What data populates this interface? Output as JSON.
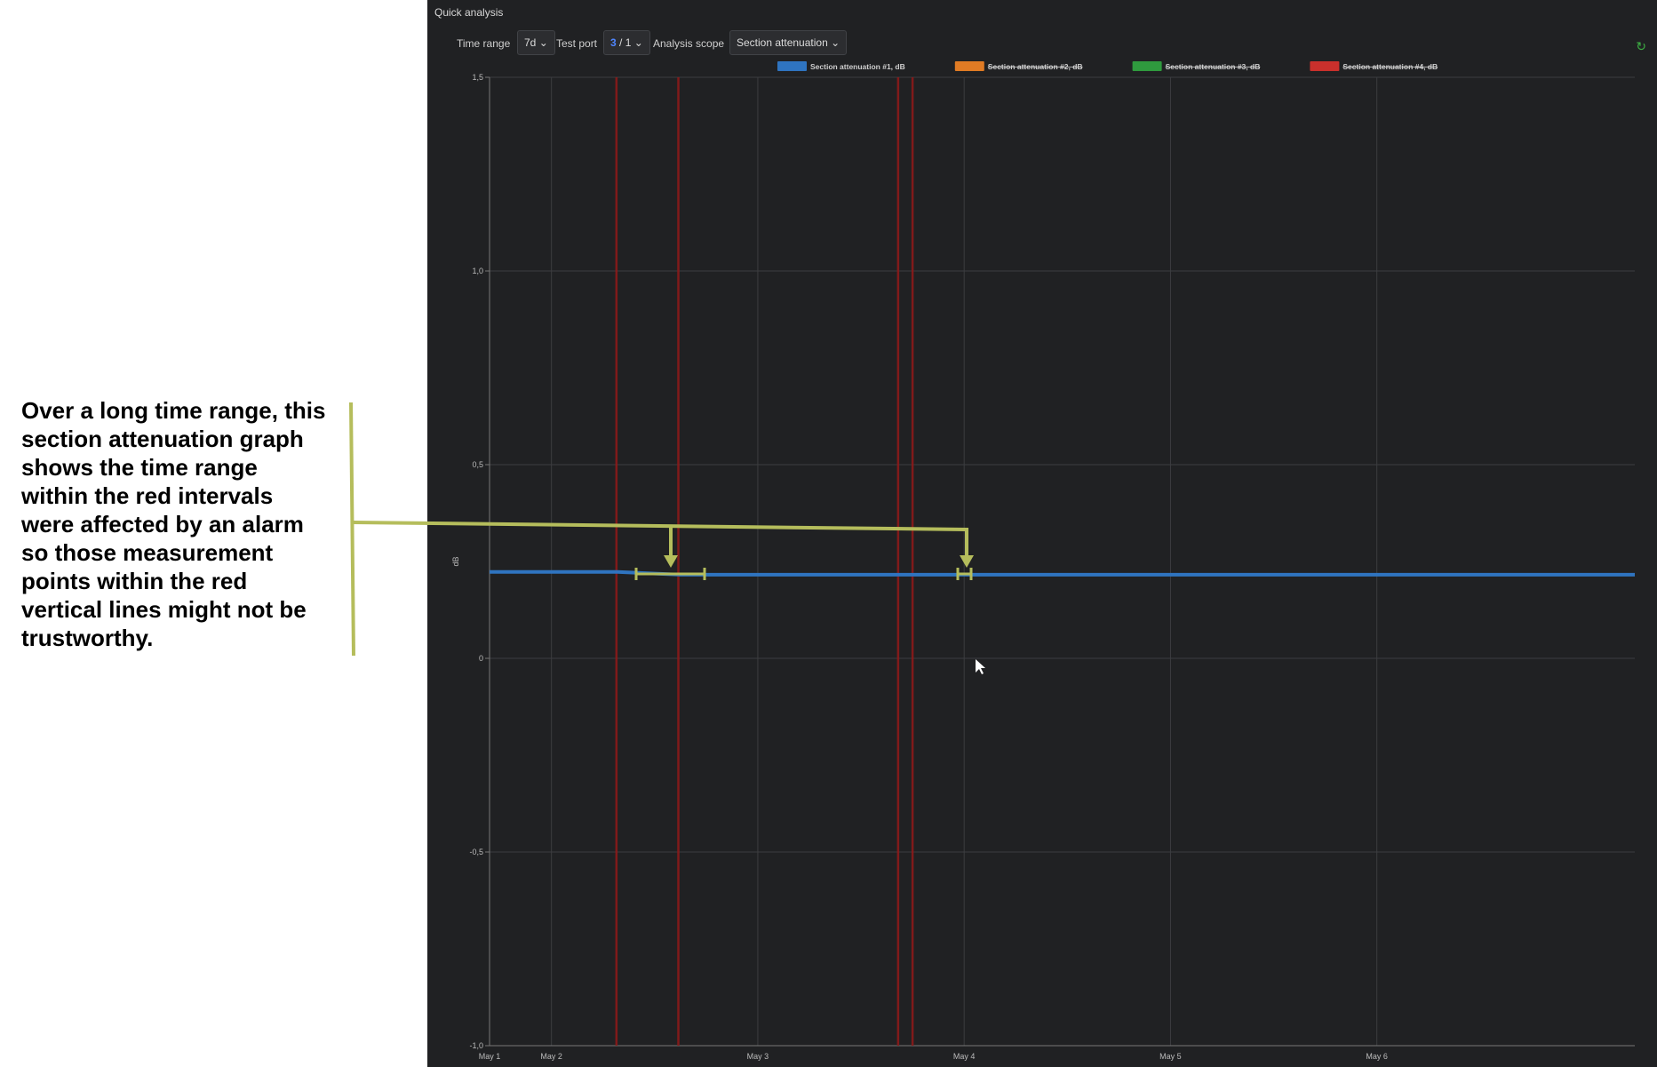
{
  "annotation": {
    "text": "Over a long time range, this\nsection attenuation graph\nshows the time range\nwithin the red intervals\nwere affected by an alarm\nso those measurement\npoints within the red\nvertical lines might not be\ntrustworthy.",
    "bracket_color": "#b5bd5c"
  },
  "panel": {
    "title": "Quick analysis",
    "toolbar": {
      "time_range_label": "Time range",
      "time_range_value": "7d",
      "test_port_label": "Test port",
      "test_port_value_a": "3",
      "test_port_value_b": " / 1",
      "analysis_scope_label": "Analysis scope",
      "analysis_scope_value": "Section attenuation",
      "chevron": "⌄",
      "refresh_icon": "↻"
    }
  },
  "chart_data": {
    "type": "line",
    "ylabel": "dB",
    "ylim": [
      -1.0,
      1.5
    ],
    "yticks": [
      "1,5",
      "1,0",
      "0,5",
      "0",
      "-0,5",
      "-1,0"
    ],
    "ytick_values": [
      1.5,
      1.0,
      0.5,
      0,
      -0.5,
      -1.0
    ],
    "xlim_days": [
      1.0,
      6.55
    ],
    "xticks": [
      "May 1",
      "May 2",
      "May 3",
      "May 4",
      "May 5",
      "May 6"
    ],
    "xtick_days": [
      1,
      1.3,
      2.3,
      3.3,
      4.3,
      5.3
    ],
    "legend": [
      {
        "name": "Section attenuation #1, dB",
        "color": "#2f74c0",
        "hidden": false
      },
      {
        "name": "Section attenuation #2, dB",
        "color": "#e07b24",
        "hidden": true
      },
      {
        "name": "Section attenuation #3, dB",
        "color": "#2f9a3e",
        "hidden": true
      },
      {
        "name": "Section attenuation #4, dB",
        "color": "#c9302c",
        "hidden": true
      }
    ],
    "series": [
      {
        "name": "Section attenuation #1, dB",
        "color": "#2f74c0",
        "x": [
          1.0,
          1.62,
          1.92,
          3.0,
          4.0,
          5.0,
          6.0,
          6.55
        ],
        "y": [
          0.223,
          0.223,
          0.216,
          0.216,
          0.216,
          0.216,
          0.216,
          0.216
        ]
      }
    ],
    "alarm_lines_days": [
      1.615,
      1.915,
      2.98,
      3.05
    ],
    "alarm_color": "#8b1a1a"
  }
}
